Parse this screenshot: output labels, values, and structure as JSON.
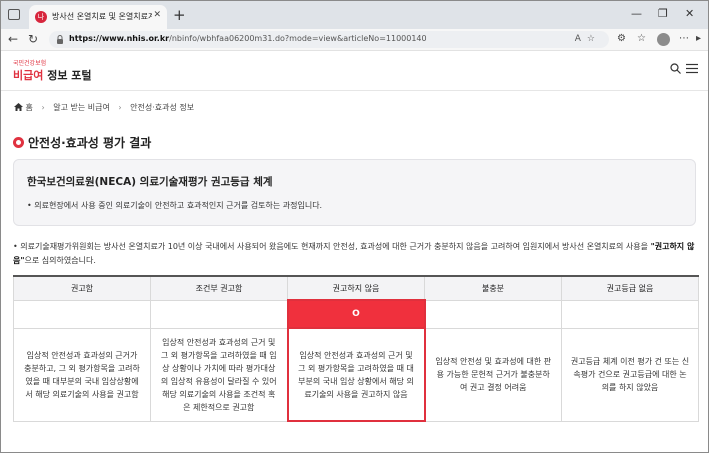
{
  "browser": {
    "tab_title": "방사선 온열치료 및 온열치료계획",
    "tab_favicon": "나",
    "tab_close_icon": "✕",
    "new_tab_icon": "+",
    "url_host": "https://www.nhis.or.kr",
    "url_path": "/nbinfo/wbhfaa06200m31.do?mode=view&articleNo=11000140",
    "window_controls": [
      "—",
      "❐",
      "✕"
    ]
  },
  "site": {
    "logo_small": "국민건강보험",
    "logo_red": "비급여",
    "logo_dark": " 정보 포털"
  },
  "breadcrumb": {
    "home": "홈",
    "level1": "알고 받는 비급여",
    "level2": "안전성·효과성 정보"
  },
  "page": {
    "title": "안전성·효과성 평가 결과"
  },
  "info_box": {
    "title": "한국보건의료원(NECA) 의료기술재평가 권고등급 체계",
    "description": "• 의료현장에서 사용 중인 의료기술이 안전하고 효과적인지 근거를 검토하는 과정입니다."
  },
  "notice": {
    "text": "• 의료기술재평가위원회는 방사선 온열치료가 10년 이상 국내에서 사용되어 왔음에도 현재까지 안전성, 효과성에 대한 근거가 충분하지 않음을 고려하여 임원지에서 방사선 온열치료의 사용을",
    "emphasis": "\"권고하지 않음\"",
    "suffix": "으로 심의하였습니다."
  },
  "grade_table": {
    "headers": [
      "권고함",
      "조건부 권고함",
      "권고하지 않음",
      "불충분",
      "권고등급 없음"
    ],
    "marks": [
      "",
      "",
      "O",
      "",
      ""
    ],
    "descriptions": [
      "임상적 안전성과 효과성의 근거가 충분하고, 그 외 평가항목을 고려하였을 때 대부분의 국내 임상상황에서 해당 의료기술의 사용을 권고함",
      "임상적 안전성과 효과성의 근거 및 그 외 평가항목을 고려하였을 때 임상 상황이나 가치에 따라 평가대상의 임상적 유용성이 달라질 수 있어 해당 의료기술의 사용을 조건적 혹은 제한적으로 권고함",
      "임상적 안전성과 효과성의 근거 및 그 외 평가항목을 고려하였을 때 대부분의 국내 임상 상황에서 해당 의료기술의 사용을 권고하지 않음",
      "임상적 안전성 및 효과성에 대한 판용 가능한 문헌적 근거가 불충분하여 권고 결정 어려움",
      "권고등급 체계 이전 평가 건 또는 신속평가 건으로 권고등급에 대한 논의를 하지 않았음"
    ],
    "highlight_index": 2
  },
  "colors": {
    "accent": "#e03240",
    "highlight": "#f0303d"
  }
}
